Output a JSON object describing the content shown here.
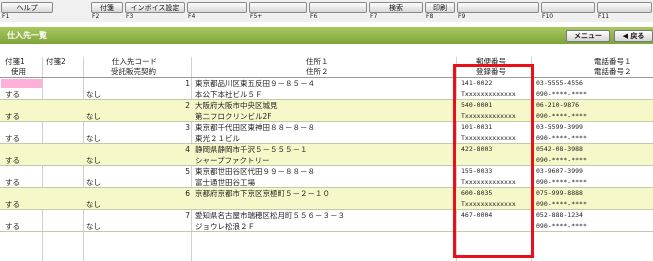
{
  "fkeys": [
    {
      "num": "F1",
      "label": "ヘルプ"
    },
    {
      "num": "F2",
      "label": "付箋"
    },
    {
      "num": "F3",
      "label": "インボイス設定"
    },
    {
      "num": "F4",
      "label": ""
    },
    {
      "num": "F5+",
      "label": ""
    },
    {
      "num": "F6",
      "label": ""
    },
    {
      "num": "F7",
      "label": "検索"
    },
    {
      "num": "F8",
      "label": "印刷"
    },
    {
      "num": "F9",
      "label": ""
    },
    {
      "num": "F10",
      "label": ""
    },
    {
      "num": "F11",
      "label": ""
    }
  ],
  "screen": {
    "title": "仕入先一覧",
    "menu_button": "メニュー",
    "back_button": "◀ 戻る"
  },
  "header": {
    "row1": {
      "c1": "付箋1",
      "c2": "付箋2",
      "code": "仕入先コード",
      "addr": "住所１",
      "zip": "郵便番号",
      "tel": "電話番号１"
    },
    "row2": {
      "c1": "使用",
      "code": "受託販売契約",
      "addr": "住所２",
      "reg": "登録番号",
      "tel": "電話番号２"
    }
  },
  "rows": [
    {
      "use": "する",
      "consign": "なし",
      "no": "1",
      "addr1": "東京都品川区東五反田９－８５－４",
      "addr2": "本公下本社ビル５Ｆ",
      "zip": "141-0022",
      "reg": "Txxxxxxxxxxxxx",
      "tel1": "03-5555-4556",
      "tel2": "090-****-****"
    },
    {
      "use": "する",
      "consign": "なし",
      "no": "2",
      "addr1": "大阪府大阪市中央区城見",
      "addr2": "第二フロクリンビル2F",
      "zip": "540-0001",
      "reg": "Txxxxxxxxxxxxx",
      "tel1": "06-210-9876",
      "tel2": "090-****-****"
    },
    {
      "use": "する",
      "consign": "なし",
      "no": "3",
      "addr1": "東京都千代田区東神田８８－８－８",
      "addr2": "東光２１ビル",
      "zip": "101-0031",
      "reg": "Txxxxxxxxxxxxx",
      "tel1": "03-5599-3999",
      "tel2": "090-****-****"
    },
    {
      "use": "する",
      "consign": "なし",
      "no": "4",
      "addr1": "静岡県静岡市千沢５－５５５－１",
      "addr2": "シャープファクトリー",
      "zip": "422-8003",
      "reg": "",
      "tel1": "0542-08-3988",
      "tel2": "090-****-****"
    },
    {
      "use": "する",
      "consign": "なし",
      "no": "5",
      "addr1": "東京都世田谷区代田９９－８８－８",
      "addr2": "富士通世田谷工場",
      "zip": "155-0033",
      "reg": "Txxxxxxxxxxxxx",
      "tel1": "03-9607-3999",
      "tel2": "090-****-****"
    },
    {
      "use": "する",
      "consign": "なし",
      "no": "6",
      "addr1": "京都府京都市下京区京極町５－２－１０",
      "addr2": "",
      "zip": "600-8035",
      "reg": "Txxxxxxxxxxxxx",
      "tel1": "075-999-8888",
      "tel2": "090-****-****"
    },
    {
      "use": "する",
      "consign": "なし",
      "no": "7",
      "addr1": "愛知県名古屋市瑞穂区松月町５５６－３－３",
      "addr2": "ジョウレ松浪２Ｆ",
      "zip": "467-0004",
      "reg": "",
      "tel1": "052-888-1234",
      "tel2": "090-****-****"
    }
  ]
}
